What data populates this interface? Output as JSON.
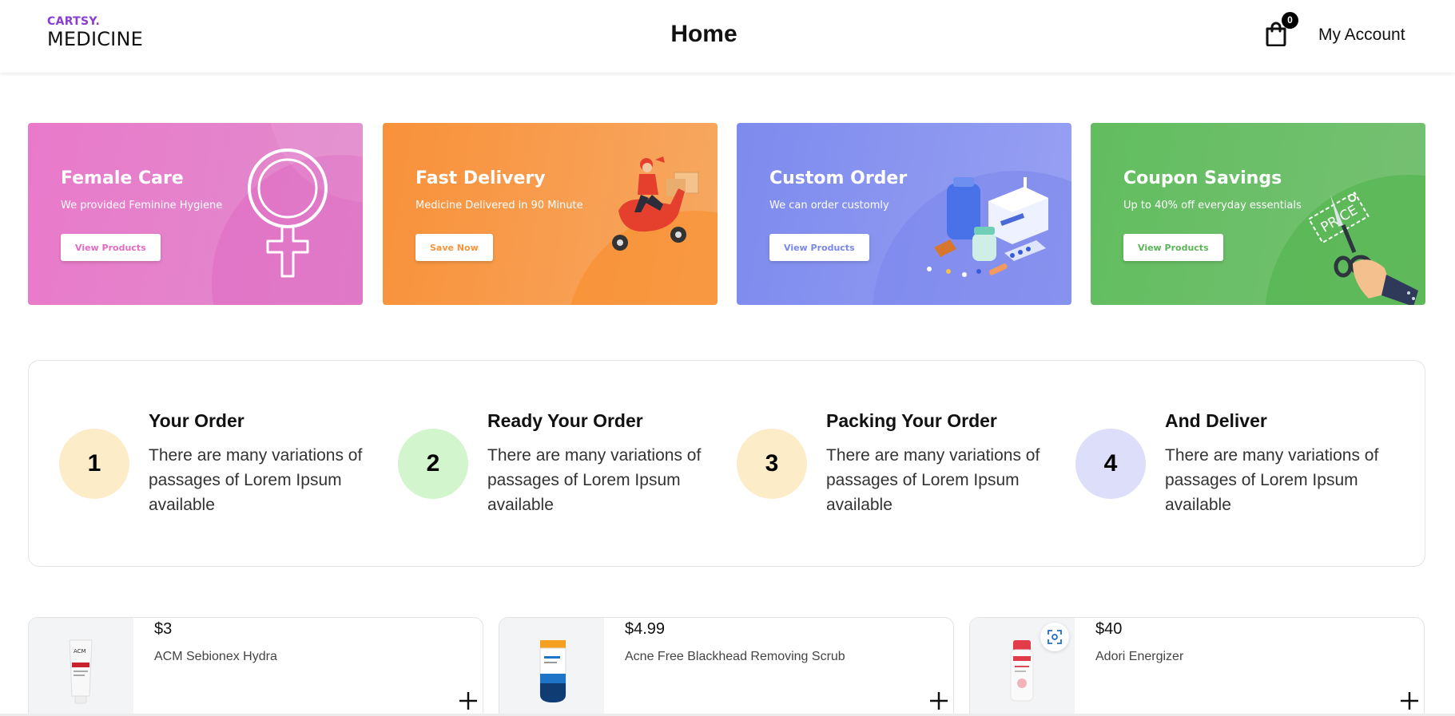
{
  "header": {
    "logo_top": "CARTSY.",
    "logo_bottom": "MEDICINE",
    "title": "Home",
    "cart_count": "0",
    "account_label": "My Account",
    "cart_icon": "shopping-bag-icon"
  },
  "promos": [
    {
      "title": "Female Care",
      "subtitle": "We provided Feminine Hygiene",
      "button": "View Products",
      "color": "#e879c9",
      "button_text_color": "#e36bc4",
      "art_icon": "female-symbol-icon"
    },
    {
      "title": "Fast Delivery",
      "subtitle": "Medicine Delivered in 90 Minute",
      "button": "Save Now",
      "color": "#f7943a",
      "button_text_color": "#f7943a",
      "art_icon": "delivery-scooter-icon"
    },
    {
      "title": "Custom Order",
      "subtitle": "We can order customly",
      "button": "View Products",
      "color": "#8490ef",
      "button_text_color": "#7a86e8",
      "art_icon": "medicine-bottles-icon"
    },
    {
      "title": "Coupon Savings",
      "subtitle": "Up to 40% off everyday essentials",
      "button": "View Products",
      "color": "#66bd63",
      "button_text_color": "#5bb558",
      "art_icon": "scissors-coupon-icon",
      "art_text": "PRICE"
    }
  ],
  "steps": [
    {
      "number": "1",
      "title": "Your Order",
      "description": "There are many variations of passages of Lorem Ipsum available",
      "color": "#fcecc8"
    },
    {
      "number": "2",
      "title": "Ready Your Order",
      "description": "There are many variations of passages of Lorem Ipsum available",
      "color": "#d3f5cd"
    },
    {
      "number": "3",
      "title": "Packing Your Order",
      "description": "There are many variations of passages of Lorem Ipsum available",
      "color": "#fcecc8"
    },
    {
      "number": "4",
      "title": "And Deliver",
      "description": "There are many variations of passages of Lorem Ipsum available",
      "color": "#dcdefa"
    }
  ],
  "products": [
    {
      "price": "$3",
      "name": "ACM Sebionex Hydra",
      "thumb_label": "ACM",
      "add_icon": "plus-icon"
    },
    {
      "price": "$4.99",
      "name": "Acne Free Blackhead Removing Scrub",
      "add_icon": "plus-icon"
    },
    {
      "price": "$40",
      "name": "Adori Energizer",
      "add_icon": "plus-icon",
      "overlay_icon": "scan-icon"
    }
  ]
}
